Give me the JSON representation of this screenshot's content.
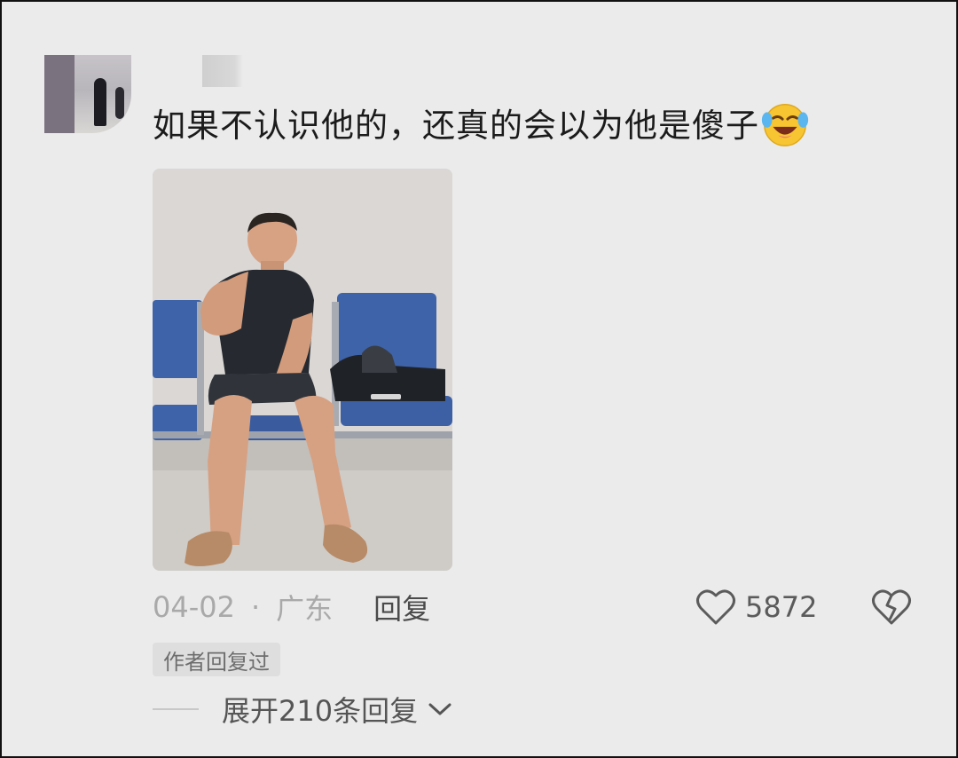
{
  "comment": {
    "text": "如果不认识他的，还真的会以为他是傻子",
    "emoji": "rolling-on-floor-laughing-emoji",
    "date": "04-02",
    "separator": "·",
    "location": "广东",
    "reply_label": "回复",
    "likes": "5872",
    "author_badge": "作者回复过",
    "expand_label": "展开210条回复"
  },
  "colors": {
    "background": "#ebebeb",
    "text": "#1b1b1b",
    "meta": "#a9a9a9",
    "seat_blue": "#3f63a8"
  }
}
